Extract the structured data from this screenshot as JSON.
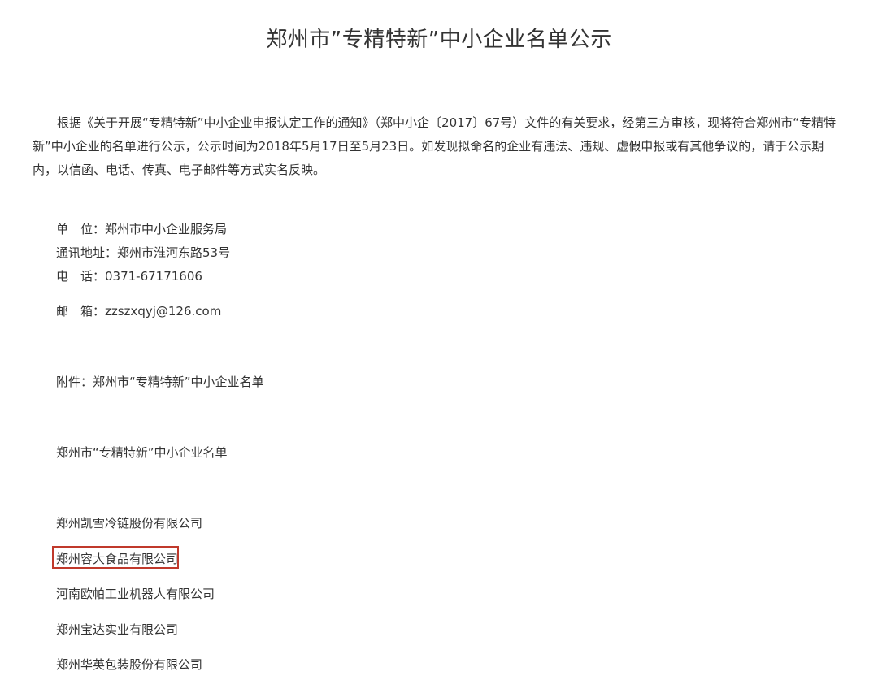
{
  "document": {
    "title": "郑州市”专精特新”中小企业名单公示",
    "intro": "根据《关于开展“专精特新”中小企业申报认定工作的通知》（郑中小企〔2017〕67号）文件的有关要求，经第三方审核，现将符合郑州市“专精特新”中小企业的名单进行公示，公示时间为2018年5月17日至5月23日。如发现拟命名的企业有违法、违规、虚假申报或有其他争议的，请于公示期内，以信函、电话、传真、电子邮件等方式实名反映。",
    "contact": {
      "unit": "单　位：郑州市中小企业服务局",
      "address": "通讯地址：郑州市淮河东路53号",
      "phone": "电　话：0371-67171606",
      "email": "邮　箱：zzszxqyj@126.com"
    },
    "attachment": "附件：郑州市“专精特新”中小企业名单",
    "list_title": "郑州市“专精特新”中小企业名单",
    "companies": [
      "郑州凯雪冷链股份有限公司",
      "郑州容大食品有限公司",
      "河南欧帕工业机器人有限公司",
      "郑州宝达实业有限公司",
      "郑州华英包装股份有限公司"
    ],
    "highlight_color": "#c0392b"
  }
}
